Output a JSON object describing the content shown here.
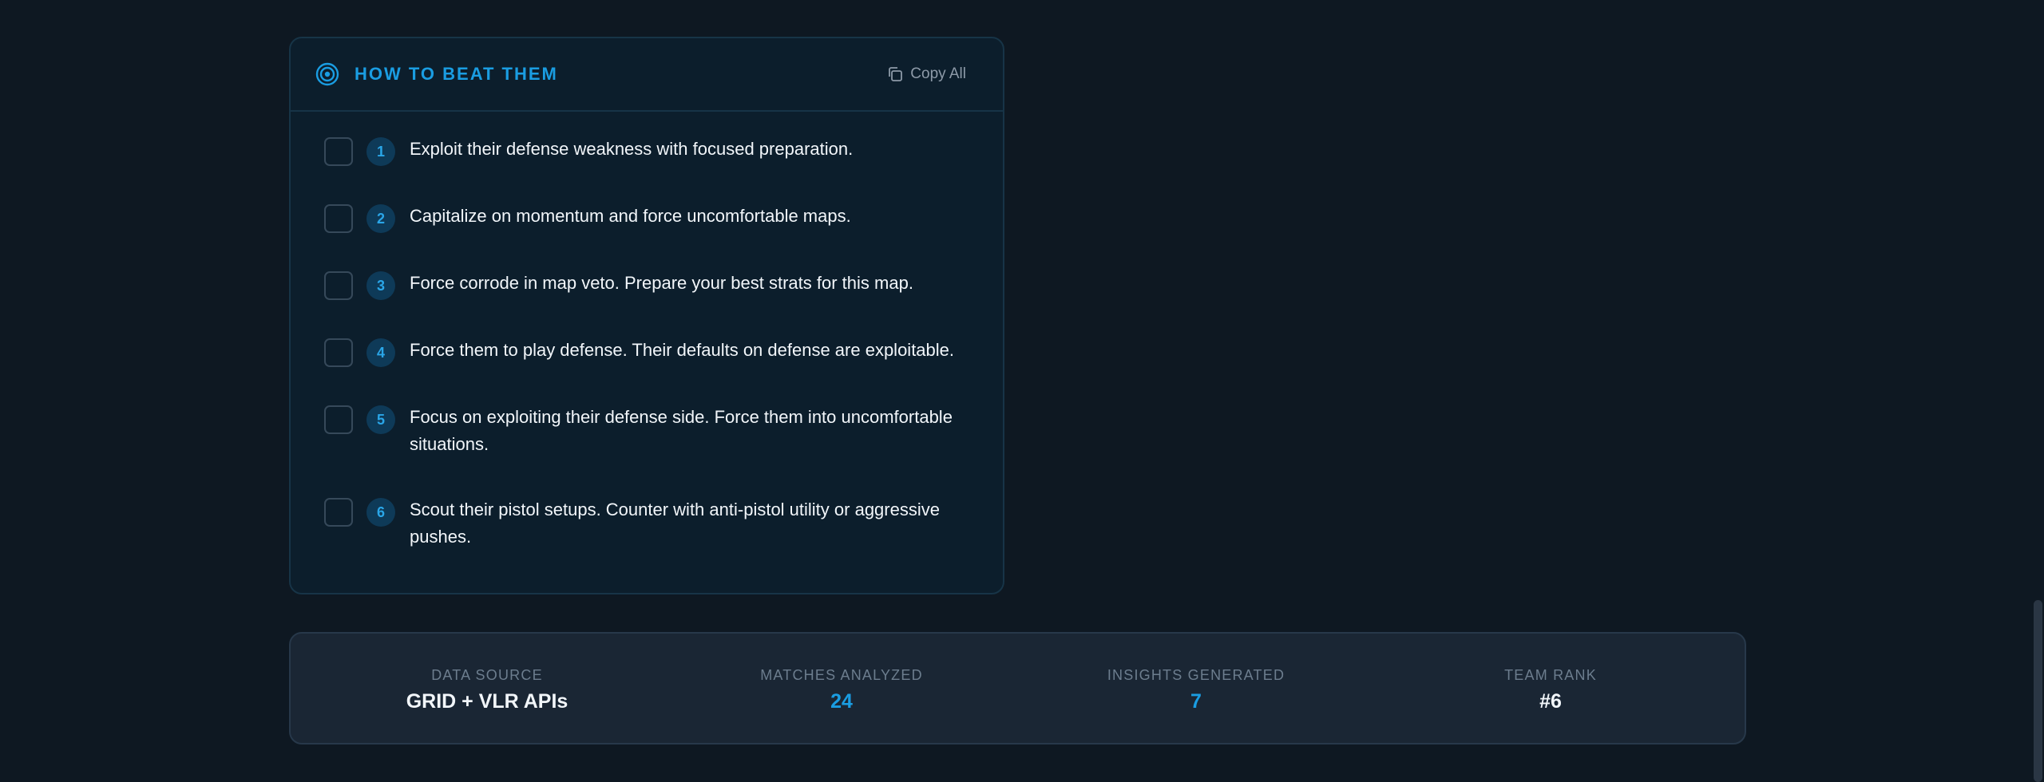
{
  "section": {
    "title": "HOW TO BEAT THEM",
    "copy_label": "Copy All",
    "icon": "target-icon",
    "accent": "#1a9de2"
  },
  "items": [
    {
      "number": "1",
      "text": "Exploit their defense weakness with focused preparation.",
      "checked": false
    },
    {
      "number": "2",
      "text": "Capitalize on momentum and force uncomfortable maps.",
      "checked": false
    },
    {
      "number": "3",
      "text": "Force corrode in map veto. Prepare your best strats for this map.",
      "checked": false
    },
    {
      "number": "4",
      "text": "Force them to play defense. Their defaults on defense are exploitable.",
      "checked": false
    },
    {
      "number": "5",
      "text": "Focus on exploiting their defense side. Force them into uncomfortable situations.",
      "checked": false
    },
    {
      "number": "6",
      "text": "Scout their pistol setups. Counter with anti-pistol utility or aggressive pushes.",
      "checked": false
    }
  ],
  "stats": [
    {
      "label": "DATA SOURCE",
      "value": "GRID + VLR APIs",
      "color": "#f2f6fa"
    },
    {
      "label": "MATCHES ANALYZED",
      "value": "24",
      "color": "#1a9de2"
    },
    {
      "label": "INSIGHTS GENERATED",
      "value": "7",
      "color": "#1a9de2"
    },
    {
      "label": "TEAM RANK",
      "value": "#6",
      "color": "#f2f6fa"
    }
  ]
}
